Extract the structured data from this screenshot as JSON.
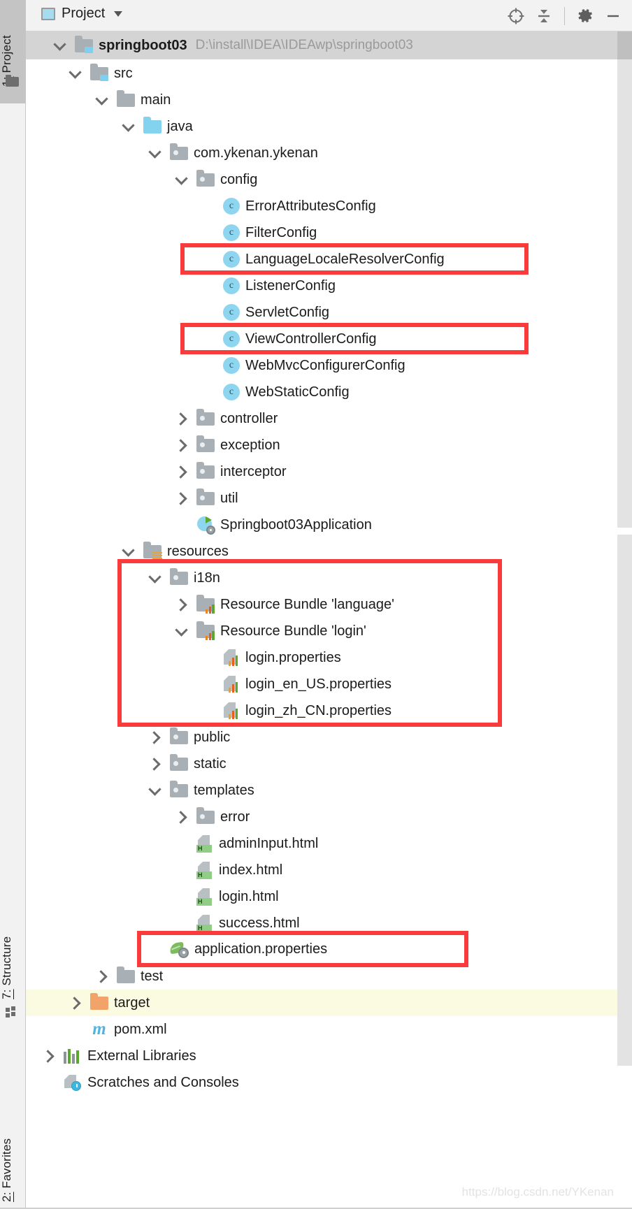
{
  "window": {
    "tool_tabs_left": [
      {
        "key": "project",
        "num": "1:",
        "label": " Project",
        "icon": "folder-icon"
      },
      {
        "key": "structure",
        "num": "7:",
        "label": " Structure",
        "icon": "structure-icon"
      },
      {
        "key": "favorites",
        "num": "2:",
        "label": " Favorites",
        "icon": "star-icon"
      }
    ]
  },
  "header": {
    "title": "Project",
    "dropdown_icon": "chevron-down-icon",
    "view_icon": "project-view-icon",
    "actions": [
      {
        "name": "scroll-from-source-icon",
        "tooltip": "Select Opened File"
      },
      {
        "name": "collapse-all-icon",
        "tooltip": "Collapse All"
      },
      {
        "name": "gear-icon",
        "tooltip": "Settings"
      },
      {
        "name": "minimize-icon",
        "tooltip": "Hide"
      }
    ]
  },
  "root": {
    "name": "springboot03",
    "path": "D:\\install\\IDEA\\IDEAwp\\springboot03",
    "expanded": true
  },
  "tree": [
    {
      "id": "src",
      "label": "src",
      "depth": 1,
      "icon": "folder-src",
      "state": "expanded"
    },
    {
      "id": "main",
      "label": "main",
      "depth": 2,
      "icon": "folder",
      "state": "expanded"
    },
    {
      "id": "java",
      "label": "java",
      "depth": 3,
      "icon": "folder-blue",
      "state": "expanded"
    },
    {
      "id": "pkg",
      "label": "com.ykenan.ykenan",
      "depth": 4,
      "icon": "folder-package",
      "state": "expanded"
    },
    {
      "id": "config",
      "label": "config",
      "depth": 5,
      "icon": "folder-package",
      "state": "expanded"
    },
    {
      "id": "c1",
      "label": "ErrorAttributesConfig",
      "depth": 6,
      "icon": "java-class",
      "state": "leaf"
    },
    {
      "id": "c2",
      "label": "FilterConfig",
      "depth": 6,
      "icon": "java-class",
      "state": "leaf"
    },
    {
      "id": "c3",
      "label": "LanguageLocaleResolverConfig",
      "depth": 6,
      "icon": "java-class",
      "state": "leaf",
      "highlighted": true
    },
    {
      "id": "c4",
      "label": "ListenerConfig",
      "depth": 6,
      "icon": "java-class",
      "state": "leaf"
    },
    {
      "id": "c5",
      "label": "ServletConfig",
      "depth": 6,
      "icon": "java-class",
      "state": "leaf"
    },
    {
      "id": "c6",
      "label": "ViewControllerConfig",
      "depth": 6,
      "icon": "java-class",
      "state": "leaf",
      "highlighted": true
    },
    {
      "id": "c7",
      "label": "WebMvcConfigurerConfig",
      "depth": 6,
      "icon": "java-class",
      "state": "leaf"
    },
    {
      "id": "c8",
      "label": "WebStaticConfig",
      "depth": 6,
      "icon": "java-class",
      "state": "leaf"
    },
    {
      "id": "controller",
      "label": "controller",
      "depth": 5,
      "icon": "folder-package",
      "state": "collapsed"
    },
    {
      "id": "exception",
      "label": "exception",
      "depth": 5,
      "icon": "folder-package",
      "state": "collapsed"
    },
    {
      "id": "interceptor",
      "label": "interceptor",
      "depth": 5,
      "icon": "folder-package",
      "state": "collapsed"
    },
    {
      "id": "util",
      "label": "util",
      "depth": 5,
      "icon": "folder-package",
      "state": "collapsed"
    },
    {
      "id": "app",
      "label": "Springboot03Application",
      "depth": 5,
      "icon": "spring-app",
      "state": "leaf"
    },
    {
      "id": "resources",
      "label": "resources",
      "depth": 3,
      "icon": "folder-resources",
      "state": "expanded"
    },
    {
      "id": "i18n",
      "label": "i18n",
      "depth": 4,
      "icon": "folder-package",
      "state": "expanded"
    },
    {
      "id": "rb-language",
      "label": "Resource Bundle 'language'",
      "depth": 5,
      "icon": "folder-bundle",
      "state": "collapsed"
    },
    {
      "id": "rb-login",
      "label": "Resource Bundle 'login'",
      "depth": 5,
      "icon": "folder-bundle",
      "state": "expanded"
    },
    {
      "id": "p1",
      "label": "login.properties",
      "depth": 6,
      "icon": "properties-file",
      "state": "leaf"
    },
    {
      "id": "p2",
      "label": "login_en_US.properties",
      "depth": 6,
      "icon": "properties-file",
      "state": "leaf"
    },
    {
      "id": "p3",
      "label": "login_zh_CN.properties",
      "depth": 6,
      "icon": "properties-file",
      "state": "leaf"
    },
    {
      "id": "public",
      "label": "public",
      "depth": 4,
      "icon": "folder-package",
      "state": "collapsed"
    },
    {
      "id": "static",
      "label": "static",
      "depth": 4,
      "icon": "folder-package",
      "state": "collapsed"
    },
    {
      "id": "templates",
      "label": "templates",
      "depth": 4,
      "icon": "folder-package",
      "state": "expanded"
    },
    {
      "id": "error",
      "label": "error",
      "depth": 5,
      "icon": "folder-package",
      "state": "collapsed"
    },
    {
      "id": "h1",
      "label": "adminInput.html",
      "depth": 5,
      "icon": "html-file",
      "state": "leaf"
    },
    {
      "id": "h2",
      "label": "index.html",
      "depth": 5,
      "icon": "html-file",
      "state": "leaf"
    },
    {
      "id": "h3",
      "label": "login.html",
      "depth": 5,
      "icon": "html-file",
      "state": "leaf"
    },
    {
      "id": "h4",
      "label": "success.html",
      "depth": 5,
      "icon": "html-file",
      "state": "leaf"
    },
    {
      "id": "appprops",
      "label": "application.properties",
      "depth": 4,
      "icon": "spring-props",
      "state": "leaf",
      "highlighted": true
    },
    {
      "id": "test",
      "label": "test",
      "depth": 2,
      "icon": "folder",
      "state": "collapsed"
    },
    {
      "id": "target",
      "label": "target",
      "depth": 1,
      "icon": "folder-orange",
      "state": "collapsed",
      "row_highlight": true
    },
    {
      "id": "pom",
      "label": "pom.xml",
      "depth": 1,
      "icon": "maven-file",
      "state": "leaf"
    },
    {
      "id": "extlibs",
      "label": "External Libraries",
      "depth": 0,
      "icon": "library-icon",
      "state": "collapsed"
    },
    {
      "id": "scratches",
      "label": "Scratches and Consoles",
      "depth": 0,
      "icon": "scratches-icon",
      "state": "leaf"
    }
  ],
  "annotations": {
    "color": "#f93b3b",
    "boxes": [
      {
        "name": "highlight-language-locale-resolver-config",
        "target": "LanguageLocaleResolverConfig"
      },
      {
        "name": "highlight-view-controller-config",
        "target": "ViewControllerConfig"
      },
      {
        "name": "highlight-i18n-section",
        "target": "i18n"
      },
      {
        "name": "highlight-application-properties",
        "target": "application.properties"
      }
    ]
  },
  "watermark": {
    "text": "https://blog.csdn.net/YKenan"
  },
  "scrollbars": {
    "vertical_visible": true
  }
}
